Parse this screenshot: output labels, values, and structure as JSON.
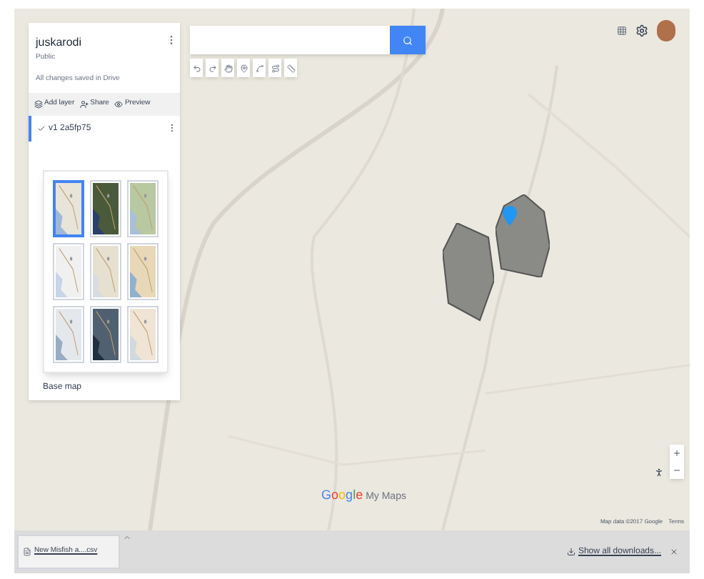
{
  "map_panel": {
    "title": "juskarodi",
    "visibility": "Public",
    "save_status": "All changes saved in Drive",
    "actions": [
      {
        "kind": "layer",
        "label": "Add layer"
      },
      {
        "kind": "share",
        "label": "Share"
      },
      {
        "kind": "preview",
        "label": "Preview"
      }
    ],
    "layer": {
      "name": "v1 2a5fp75",
      "checked": true
    },
    "base_map_styles": [
      {
        "selected": true
      },
      {
        "selected": false
      },
      {
        "selected": false
      },
      {
        "selected": false
      },
      {
        "selected": false
      },
      {
        "selected": false
      },
      {
        "selected": false
      },
      {
        "selected": false
      },
      {
        "selected": false
      }
    ],
    "base_map_label": "Base map"
  },
  "logo": {
    "brand": "Google",
    "product": "My Maps"
  },
  "attribution": [
    "Map data ©2017 Google",
    "Terms"
  ],
  "downloads_bar": {
    "file": "New Misfish a....csv",
    "show_all": "Show all downloads..."
  }
}
